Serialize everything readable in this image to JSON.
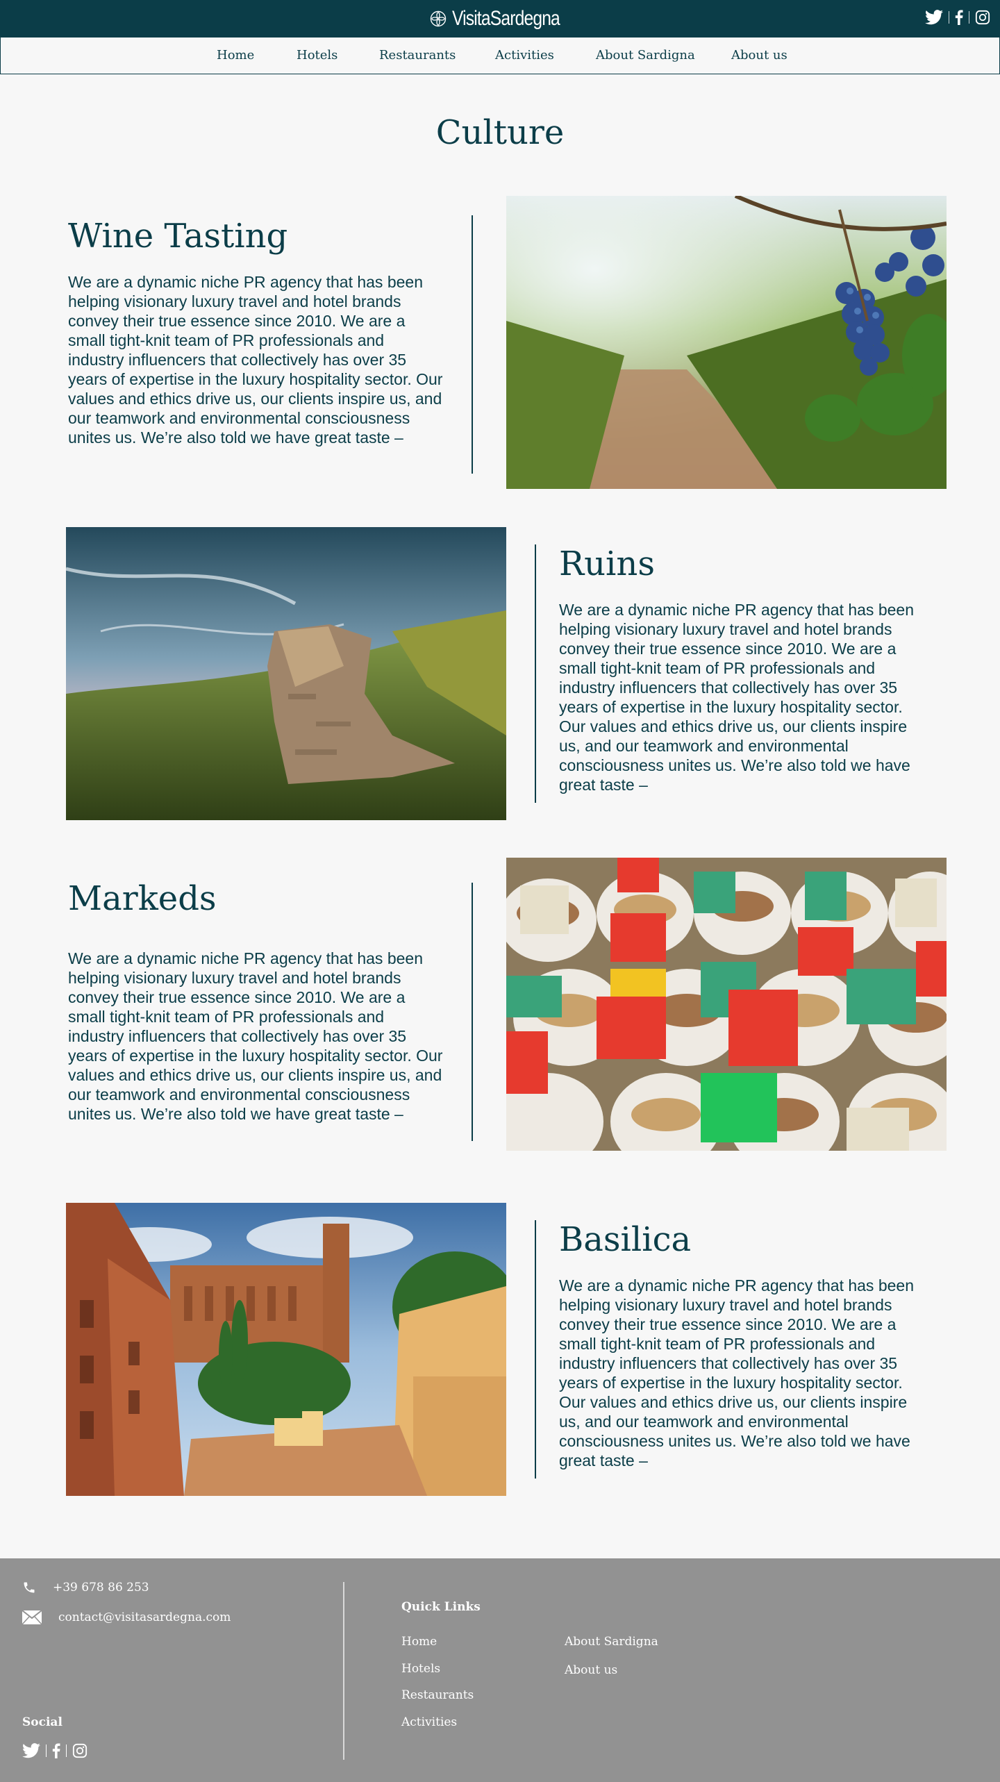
{
  "header": {
    "brand": "VisitaSardegna",
    "icons": [
      "flower-logo-icon",
      "twitter-icon",
      "facebook-icon",
      "instagram-icon"
    ]
  },
  "nav": {
    "items": [
      {
        "label": "Home"
      },
      {
        "label": "Hotels"
      },
      {
        "label": "Restaurants"
      },
      {
        "label": "Activities"
      },
      {
        "label": "About Sardigna"
      },
      {
        "label": "About us"
      }
    ]
  },
  "main": {
    "title": "Culture",
    "sections": [
      {
        "title": "Wine Tasting",
        "body": "We are a dynamic niche PR agency that has been helping visionary luxury travel and hotel brands convey their true essence since 2010. We are a small tight-knit team of PR professionals and industry influencers that collectively has over 35 years of expertise in the luxury hospitality sector. Our values and ethics drive us, our clients inspire us, and our teamwork and environmental consciousness unites us. We’re also told we have great taste –",
        "image": "vineyard-grapes-photo"
      },
      {
        "title": "Ruins",
        "body": "We are a dynamic niche PR agency that has been helping visionary luxury travel and hotel brands convey their true essence since 2010. We are a small tight-knit team of PR professionals and industry influencers that collectively has over 35 years of expertise in the luxury hospitality sector. Our values and ethics drive us, our clients inspire us, and our teamwork and environmental consciousness unites us. We’re also told we have great taste –",
        "image": "stone-ruin-photo"
      },
      {
        "title": "Markeds",
        "body": "We are a dynamic niche PR agency that has been helping visionary luxury travel and hotel brands convey their true essence since 2010. We are a small tight-knit team of PR professionals and industry influencers that collectively has over 35 years of expertise in the luxury hospitality sector. Our values and ethics drive us, our clients inspire us, and our teamwork and environmental consciousness unites us. We’re also told we have great taste –",
        "image": "market-stall-photo"
      },
      {
        "title": "Basilica",
        "body": "We are a dynamic niche PR agency that has been helping visionary luxury travel and hotel brands convey their true essence since 2010. We are a small tight-knit team of PR professionals and industry influencers that collectively has over 35 years of expertise in the luxury hospitality sector. Our values and ethics drive us, our clients inspire us, and our teamwork and environmental consciousness unites us. We’re also told we have great taste –",
        "image": "basilica-street-photo"
      }
    ]
  },
  "footer": {
    "phone": "+39 678 86 253",
    "email": "contact@visitasardegna.com",
    "quick_links_title": "Quick Links",
    "quick_links": [
      {
        "label": "Home"
      },
      {
        "label": "Hotels"
      },
      {
        "label": "Restaurants"
      },
      {
        "label": "Activities"
      },
      {
        "label": "About Sardigna"
      },
      {
        "label": "About us"
      }
    ],
    "social_title": "Social"
  },
  "colors": {
    "primary": "#0b3d48",
    "background": "#f7f7f7",
    "footer": "#929292"
  }
}
